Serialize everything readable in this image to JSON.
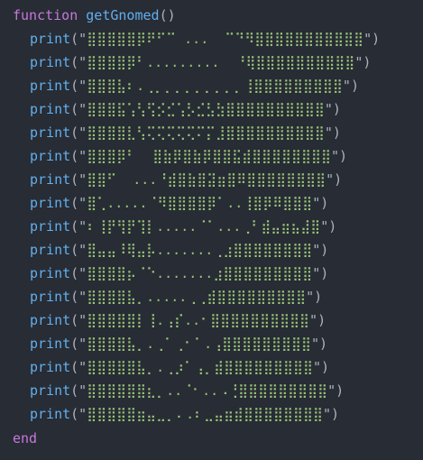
{
  "code": {
    "keyword_function": "function",
    "function_name": "getGnomed",
    "parens": "()",
    "keyword_end": "end",
    "print_call": "print",
    "open": "(\"",
    "close": "\")",
    "lines": [
      "⣿⣿⣿⣿⣿⡿⠟⠋⠉ ...  ⠉⠙⠻⣿⣿⣿⣿⣿⣿⣿⣿⣿⣿⣿",
      "⣿⣿⣿⣿⡿⠃.........  ⠘⢿⣿⣿⣿⣿⣿⣿⣿⣿⣿⣿",
      "⣿⣿⣿⣧⠆.⢀⡀⡀⡀⡀⡀⡀⡀⡀⡀⢸⣿⣿⣿⣿⣿⣿⣿⣿⣿",
      "⣿⣿⣿⣯⢡⢣⢫⡪⣊⢡⡣⣊⣣⣳⣿⣿⣿⣿⣿⣿⣿⣿⣿⣿",
      "⣿⣿⣿⣿⣇⢣⢍⢍⢍⢍⢍⠍⡍⣸⣿⣿⣿⣿⣿⣿⣿⣿⣿⣿",
      "⣿⣿⣿⡿⠃  ⣿⣷⡿⣿⣷⡿⣿⣿⣯⣾⣿⣿⣿⣿⣿⣿⣿⣿",
      "⣿⣿⠋  ...⠘⣾⣿⣷⣿⣽⣶⣿⠿⣿⣿⣿⣿⣿⣿⣿⣿",
      "⣿⢁.....⠈⠻⣿⣿⣿⣿⡿⠁..⢸⣿⡿⠿⣿⣿⣿",
      "⠆⢸⡟⢻⡟⢹⡇.....⠈⠁...⢀⠃⣾⣤⣶⣦⣼⣿",
      "⣿⣤⣤⠸⢿⣤⡧.......⢀⣰⣿⣿⣿⣿⣿⣿⣿⣿",
      "⣿⣿⣿⣿⡦⠈⠑.......⣰⣿⣿⣿⣿⣿⣿⣿⣿⣿",
      "⣿⣿⣿⣿⣧⡀.....⢀⢀⣾⣿⣿⣿⣿⣿⣿⣿⣿⣿",
      "⣿⣿⣿⣿⣿⡇⢸.⢠⡎..⠂⣿⣿⣿⣿⣿⣿⣿⣿⣿⣿",
      "⣿⣿⣿⣿⣧⡀.⢀⠁⢀⠂⠁.⢠⣿⣿⣿⣿⣿⣿⣿⣿⣿",
      "⣿⣿⣿⣿⣿⣧⡀.⢀⡰⠁⢠⡀⣾⣿⣿⣿⣿⣿⣿⣿⣿⣿",
      "⣿⣿⣿⣿⣿⣿⣆⡀..⠈⠂..⠠⢘⣿⣿⣿⣿⣿⣿⣿⣿⣿",
      "⣿⣿⣿⣿⣿⣶⣤⣀⡀⠄.⠆⣀⣤⣶⣾⣿⣿⣿⣿⣿⣿⣿⣿"
    ]
  },
  "colors": {
    "background": "#282c34",
    "keyword": "#c678dd",
    "function": "#61afef",
    "string": "#98c379",
    "punctuation": "#abb2bf"
  }
}
